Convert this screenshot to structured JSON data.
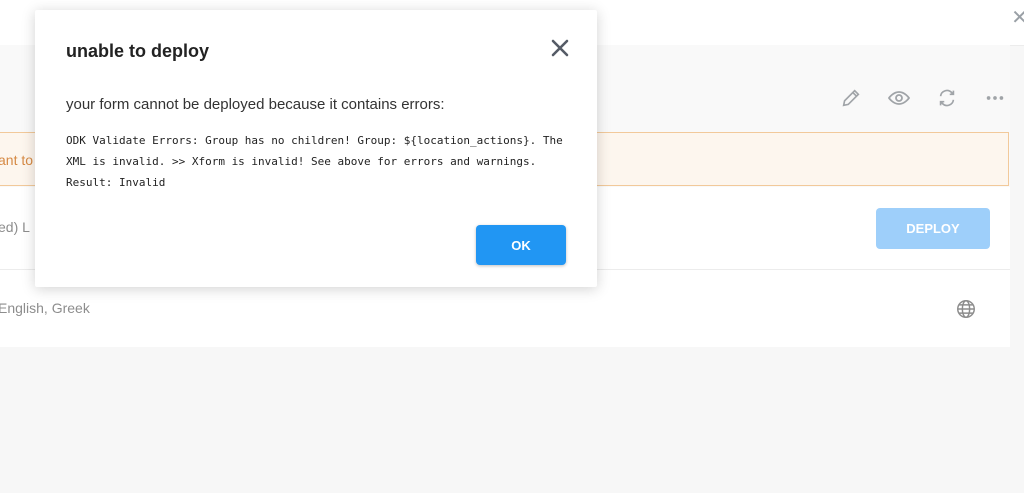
{
  "topbar": {
    "close_glyph": "✕"
  },
  "warning": {
    "text": "ant to"
  },
  "deploy_row": {
    "status": "ed)  L",
    "deploy_label": "DEPLOY"
  },
  "languages": {
    "text": "English, Greek"
  },
  "icons": [
    "pencil-icon",
    "eye-icon",
    "refresh-icon",
    "more-icon",
    "globe-icon"
  ],
  "modal": {
    "title": "unable to deploy",
    "message": "your form cannot be deployed because it contains errors:",
    "errors": "ODK Validate Errors: Group has no children! Group: ${location_actions}. The XML is invalid. >> Xform is invalid! See above for errors and warnings. Result: Invalid",
    "ok_label": "OK"
  },
  "colors": {
    "primary": "#2196f3",
    "deploy_disabled": "#9ecffa",
    "warning_bg": "#fdf6ee",
    "warning_border": "#f2c99a",
    "icon_gray": "#9aa0a6"
  }
}
